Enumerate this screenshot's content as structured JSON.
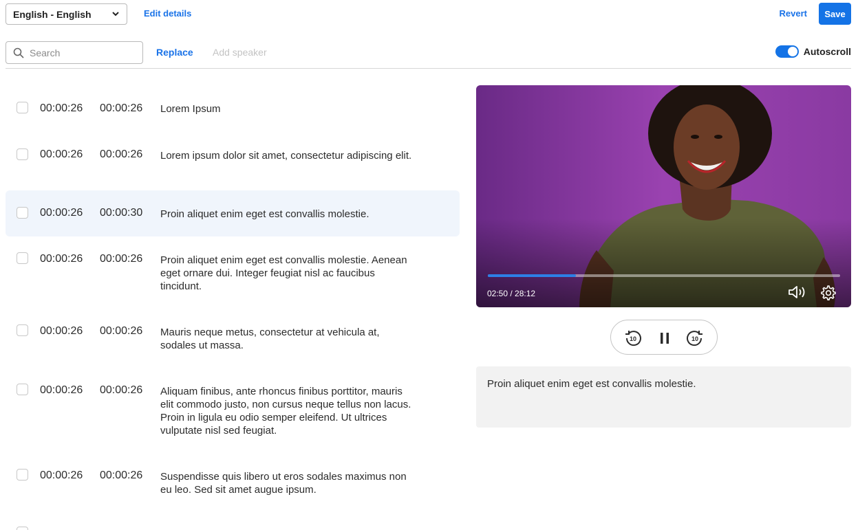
{
  "toolbar": {
    "language": "English - English",
    "edit_details": "Edit details",
    "revert": "Revert",
    "save": "Save"
  },
  "editor_bar": {
    "search_placeholder": "Search",
    "replace": "Replace",
    "add_speaker": "Add speaker",
    "autoscroll_label": "Autoscroll",
    "autoscroll_on": true
  },
  "captions": [
    {
      "start": "00:00:26",
      "end": "00:00:26",
      "text": "Lorem Ipsum",
      "active": false
    },
    {
      "start": "00:00:26",
      "end": "00:00:26",
      "text": "Lorem ipsum dolor sit amet, consectetur adipiscing elit.",
      "active": false
    },
    {
      "start": "00:00:26",
      "end": "00:00:30",
      "text": "Proin aliquet enim eget est convallis molestie.",
      "active": true
    },
    {
      "start": "00:00:26",
      "end": "00:00:26",
      "text": "Proin aliquet enim eget est convallis molestie. Aenean eget ornare dui. Integer feugiat nisl ac faucibus tincidunt.",
      "active": false
    },
    {
      "start": "00:00:26",
      "end": "00:00:26",
      "text": "Mauris neque metus, consectetur at vehicula at, sodales ut massa.",
      "active": false
    },
    {
      "start": "00:00:26",
      "end": "00:00:26",
      "text": "Aliquam finibus, ante rhoncus finibus porttitor, mauris elit commodo justo, non cursus neque tellus non lacus. Proin in ligula eu odio semper eleifend. Ut ultrices vulputate nisl sed feugiat.",
      "active": false
    },
    {
      "start": "00:00:26",
      "end": "00:00:26",
      "text": "Suspendisse quis libero ut eros sodales maximus non eu leo. Sed sit amet augue ipsum.",
      "active": false
    }
  ],
  "player": {
    "time": "02:50 / 28:12",
    "progress": 0.25,
    "rewind_label": "10",
    "forward_label": "10"
  },
  "caption_preview": {
    "text": "Proin aliquet enim eget est convallis molestie."
  },
  "colors": {
    "accent": "#1473e6",
    "active_row": "#f0f5fc",
    "video_bg": "#8e3aa6"
  }
}
